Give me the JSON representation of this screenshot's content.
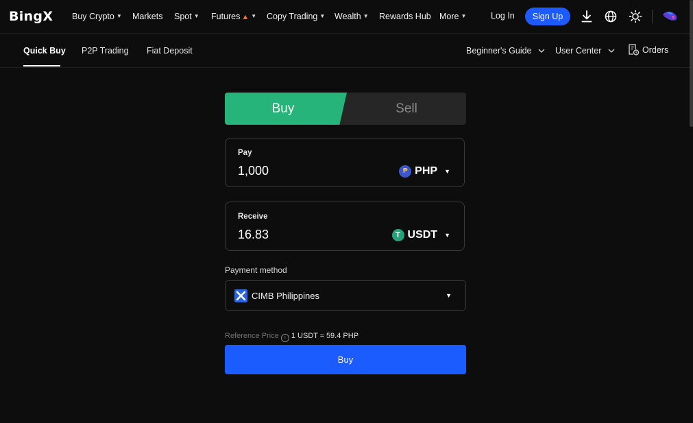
{
  "brand": {
    "logo_text": "BingX"
  },
  "topnav": {
    "items": [
      {
        "label": "Buy Crypto",
        "dropdown": true
      },
      {
        "label": "Markets",
        "dropdown": false
      },
      {
        "label": "Spot",
        "dropdown": true
      },
      {
        "label": "Futures",
        "dropdown": true,
        "badge": "fire-icon"
      },
      {
        "label": "Copy Trading",
        "dropdown": true
      },
      {
        "label": "Wealth",
        "dropdown": true
      },
      {
        "label": "Rewards Hub",
        "dropdown": false
      },
      {
        "label": "More",
        "dropdown": true
      }
    ],
    "login_label": "Log In",
    "signup_label": "Sign Up",
    "icons": [
      "download-icon",
      "globe-icon",
      "sun-icon",
      "avatar"
    ]
  },
  "subnav": {
    "tabs": [
      {
        "label": "Quick Buy",
        "active": true
      },
      {
        "label": "P2P Trading",
        "active": false
      },
      {
        "label": "Fiat Deposit",
        "active": false
      }
    ],
    "right": [
      {
        "label": "Beginner's Guide"
      },
      {
        "label": "User Center"
      },
      {
        "label": "Orders"
      }
    ]
  },
  "trade": {
    "buy_label": "Buy",
    "sell_label": "Sell",
    "pay": {
      "label": "Pay",
      "value": "1,000",
      "currency": "PHP"
    },
    "receive": {
      "label": "Receive",
      "value": "16.83",
      "currency": "USDT"
    },
    "payment_method_label": "Payment method",
    "payment_method": "CIMB Philippines",
    "reference_label": "Reference Price",
    "reference_value": "1 USDT ≈ 59.4 PHP",
    "submit_label": "Buy"
  },
  "colors": {
    "buy_green": "#26b47a",
    "accent_blue": "#1a5cff",
    "background": "#0d0d0d"
  }
}
